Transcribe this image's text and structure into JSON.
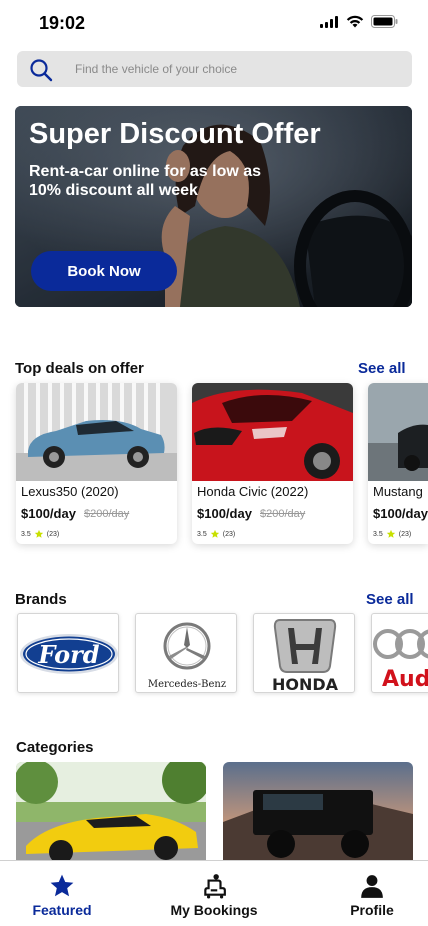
{
  "status": {
    "time": "19:02"
  },
  "search": {
    "placeholder": "Find the vehicle of your choice",
    "icon": "search-icon"
  },
  "hero": {
    "title": "Super Discount Offer",
    "subtitle": "Rent-a-car online for as low as 10% discount all week",
    "button_label": "Book Now"
  },
  "deals": {
    "title": "Top deals on offer",
    "see_all": "See all",
    "items": [
      {
        "name": "Lexus350 (2020)",
        "price": "$100/day",
        "old_price": "$200/day",
        "rating": "3.5",
        "reviews": "(23)"
      },
      {
        "name": "Honda Civic (2022)",
        "price": "$100/day",
        "old_price": "$200/day",
        "rating": "3.5",
        "reviews": "(23)"
      },
      {
        "name": "Mustang",
        "price": "$100/day",
        "old_price": "",
        "rating": "3.5",
        "reviews": "(23)"
      }
    ]
  },
  "brands": {
    "title": "Brands",
    "see_all": "See all",
    "items": [
      {
        "name": "Ford"
      },
      {
        "name": "Mercedes-Benz"
      },
      {
        "name": "HONDA"
      },
      {
        "name": "Audi"
      }
    ]
  },
  "categories": {
    "title": "Categories"
  },
  "nav": {
    "items": [
      {
        "label": "Featured",
        "icon": "star-icon",
        "active": true
      },
      {
        "label": "My Bookings",
        "icon": "car-seat-icon",
        "active": false
      },
      {
        "label": "Profile",
        "icon": "user-icon",
        "active": false
      }
    ]
  },
  "colors": {
    "accent": "#0a2a9a",
    "star": "#c8e000"
  }
}
